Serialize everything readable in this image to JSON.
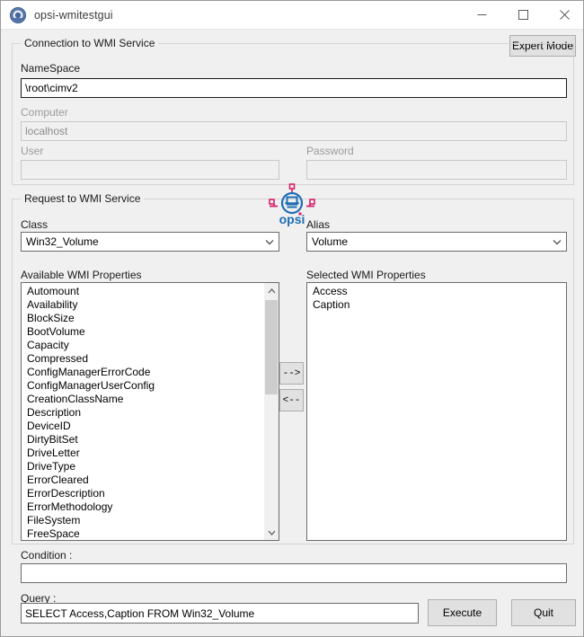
{
  "window": {
    "title": "opsi-wmitestgui",
    "icon": "opsi-app-icon",
    "controls": {
      "minimize": "—",
      "maximize": "☐",
      "close": "✕"
    }
  },
  "expert_mode_button": {
    "label": "Expert Mode"
  },
  "connection_group": {
    "title": "Connection to WMI Service",
    "namespace": {
      "label": "NameSpace",
      "value": "\\root\\cimv2",
      "placeholder": ""
    },
    "computer": {
      "label": "Computer",
      "value": "localhost",
      "placeholder": "",
      "disabled": true
    },
    "user": {
      "label": "User",
      "value": "",
      "placeholder": "",
      "disabled": true
    },
    "password": {
      "label": "Password",
      "value": "",
      "placeholder": "",
      "disabled": true
    }
  },
  "logo": {
    "text": "opsi",
    "color_blue": "#1f6eb5",
    "color_pink": "#d6216b"
  },
  "request_group": {
    "title": "Request to WMI Service",
    "class": {
      "label": "Class",
      "value": "Win32_Volume"
    },
    "alias": {
      "label": "Alias",
      "value": "Volume"
    },
    "available": {
      "label": "Available WMI Properties",
      "items": [
        "Automount",
        "Availability",
        "BlockSize",
        "BootVolume",
        "Capacity",
        "Compressed",
        "ConfigManagerErrorCode",
        "ConfigManagerUserConfig",
        "CreationClassName",
        "Description",
        "DeviceID",
        "DirtyBitSet",
        "DriveLetter",
        "DriveType",
        "ErrorCleared",
        "ErrorDescription",
        "ErrorMethodology",
        "FileSystem",
        "FreeSpace"
      ]
    },
    "selected": {
      "label": "Selected WMI Properties",
      "items": [
        "Access",
        "Caption"
      ]
    },
    "add_button": {
      "label": "-->"
    },
    "remove_button": {
      "label": "<--"
    },
    "condition": {
      "label": "Condition :",
      "value": "",
      "placeholder": ""
    }
  },
  "query_bar": {
    "label": "Query :",
    "value": "SELECT Access,Caption FROM Win32_Volume",
    "placeholder": "",
    "execute_button": "Execute",
    "quit_button": "Quit"
  }
}
